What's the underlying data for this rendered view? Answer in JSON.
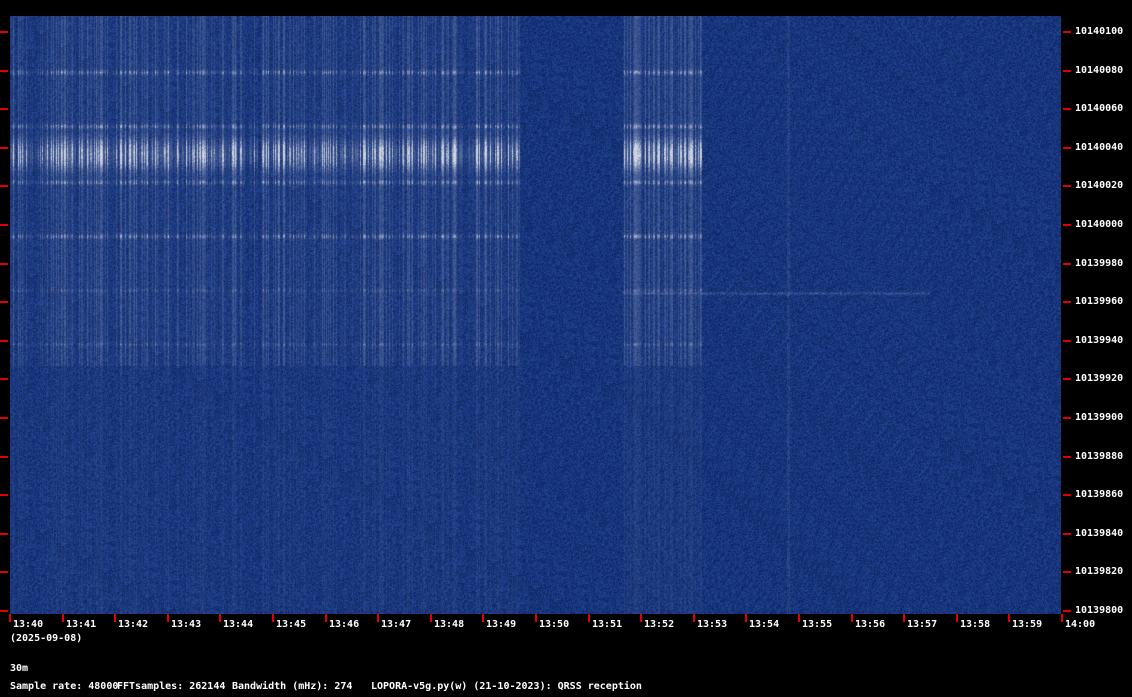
{
  "app": {
    "title": "LOPORA-v5g.py(w) (21-10-2023): QRSS reception"
  },
  "colors": {
    "background": "#000000",
    "spectrogram_base": "#0f2a6a",
    "signal": "#cfd4dc",
    "tick": "#e00000",
    "text": "#ffffff"
  },
  "frequency_axis": {
    "labels": [
      "10140100",
      "10140080",
      "10140060",
      "10140040",
      "10140020",
      "10140000",
      "10139980",
      "10139960",
      "10139940",
      "10139920",
      "10139900",
      "10139880",
      "10139860",
      "10139840",
      "10139820",
      "10139800"
    ]
  },
  "time_axis": {
    "labels": [
      "13:40",
      "13:41",
      "13:42",
      "13:43",
      "13:44",
      "13:45",
      "13:46",
      "13:47",
      "13:48",
      "13:49",
      "13:50",
      "13:51",
      "13:52",
      "13:53",
      "13:54",
      "13:55",
      "13:56",
      "13:57",
      "13:58",
      "13:59",
      "14:00"
    ],
    "date": "(2025-09-08)"
  },
  "footer": {
    "band": "30m",
    "sample_rate": "Sample rate: 48000",
    "fft_samples": "FFTsamples: 262144",
    "bandwidth": "Bandwidth (mHz): 274",
    "program": "LOPORA-v5g.py(w) (21-10-2023): QRSS reception"
  }
}
